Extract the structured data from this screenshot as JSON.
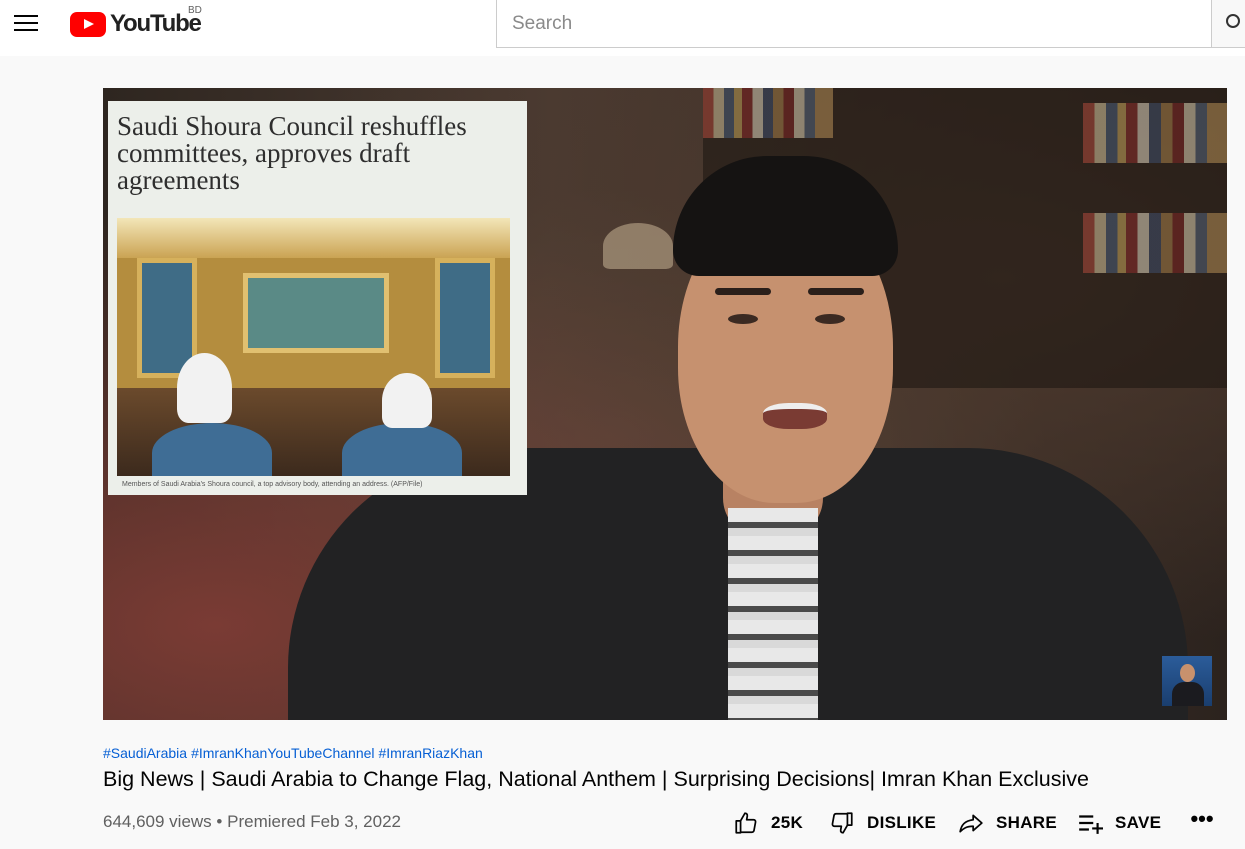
{
  "header": {
    "logo_text": "YouTube",
    "country_code": "BD",
    "search_placeholder": "Search"
  },
  "player": {
    "article": {
      "headline": "Saudi Shoura Council reshuffles committees, approves draft agreements",
      "caption": "Members of Saudi Arabia's Shoura council, a top advisory body, attending an address. (AFP/File)"
    }
  },
  "video": {
    "hashtags": [
      "#SaudiArabia",
      "#ImranKhanYouTubeChannel",
      "#ImranRiazKhan"
    ],
    "title": "Big News | Saudi Arabia to Change Flag, National Anthem | Surprising Decisions| Imran Khan Exclusive",
    "views": "644,609 views",
    "separator": "•",
    "premiered": "Premiered Feb 3, 2022"
  },
  "actions": {
    "like_count": "25K",
    "dislike_label": "DISLIKE",
    "share_label": "SHARE",
    "save_label": "SAVE",
    "more_label": "•••"
  },
  "icons": {
    "menu": "hamburger-menu-icon",
    "logo": "youtube-play-icon",
    "search": "search-icon",
    "like": "thumbs-up-icon",
    "dislike": "thumbs-down-icon",
    "share": "share-arrow-icon",
    "save": "playlist-add-icon",
    "more": "more-horizontal-icon"
  },
  "colors": {
    "brand_red": "#ff0000",
    "link_blue": "#065fd4",
    "background": "#f9f9f9"
  }
}
